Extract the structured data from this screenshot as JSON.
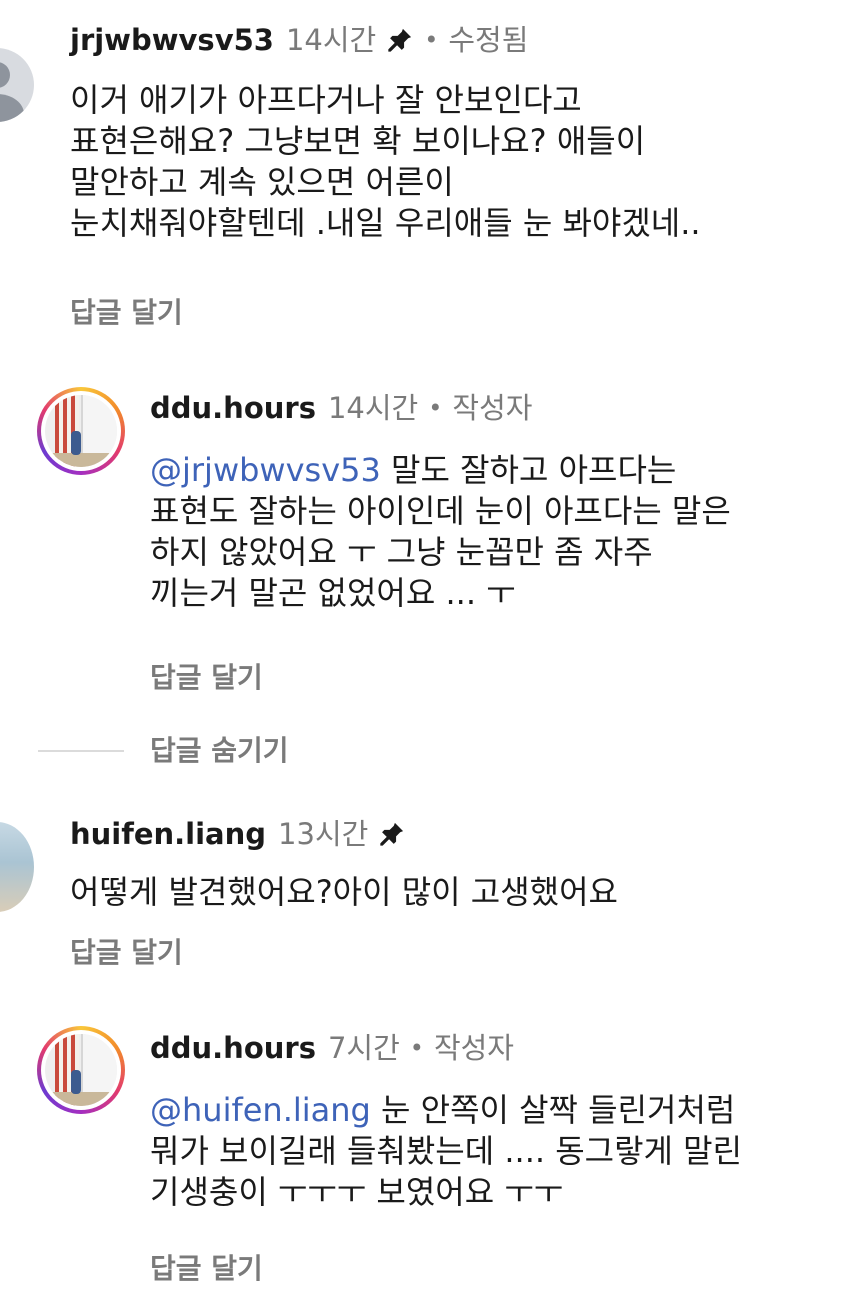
{
  "comments": [
    {
      "username": "jrjwbwvsv53",
      "time": "14시간",
      "pinned": true,
      "edited_label": "수정됨",
      "text": "이거 애기가 아프다거나  잘 안보인다고\n표현은해요? 그냥보면 확 보이나요? 애들이\n말안하고 계속 있으면 어른이\n눈치채줘야할텐데 .내일 우리애들 눈 봐야겠네..",
      "reply_label": "답글 달기",
      "replies": [
        {
          "username": "ddu.hours",
          "time": "14시간",
          "author_label": "작성자",
          "mention": "@jrjwbwvsv53",
          "text": " 말도 잘하고 아프다는\n표현도 잘하는 아이인데 눈이 아프다는 말은\n하지 않았어요 ㅜ 그냥 눈꼽만 좀 자주\n끼는거 말곤 없었어요 ... ㅜ",
          "reply_label": "답글 달기"
        }
      ],
      "hide_replies_label": "답글 숨기기"
    },
    {
      "username": "huifen.liang",
      "time": "13시간",
      "pinned": true,
      "text": "어떻게 발견했어요?아이 많이 고생했어요",
      "reply_label": "답글 달기",
      "replies": [
        {
          "username": "ddu.hours",
          "time": "7시간",
          "author_label": "작성자",
          "mention": "@huifen.liang",
          "text": " 눈 안쪽이 살짝 들린거처럼\n뭐가 보이길래 들춰봤는데 .... 동그랗게 말린\n기생충이 ㅜㅜㅜ 보였어요 ㅜㅜ",
          "reply_label": "답글 달기"
        }
      ]
    }
  ],
  "icons": {
    "pin": "pin-icon",
    "separator": "•"
  },
  "colors": {
    "text": "#1a1a1a",
    "muted": "#7a7a7a",
    "mention": "#3e63b8"
  }
}
